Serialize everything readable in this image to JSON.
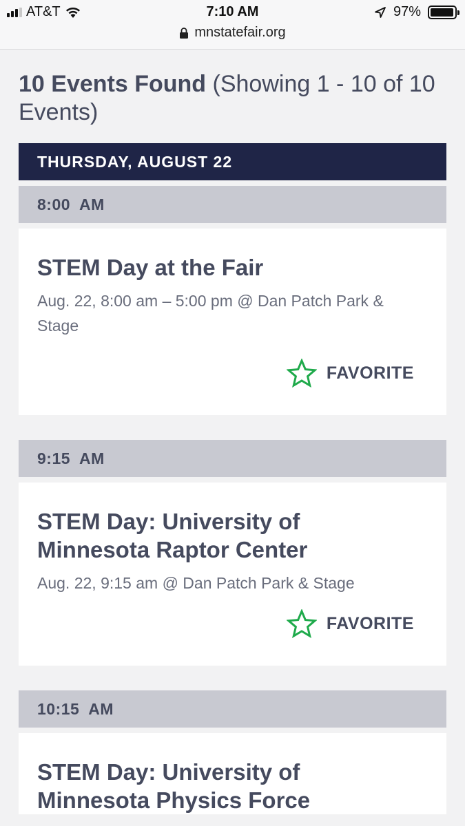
{
  "status_bar": {
    "carrier": "AT&T",
    "time": "7:10 AM",
    "battery": "97%",
    "battery_level": 0.97,
    "signal_bars": 3
  },
  "browser": {
    "url": "mnstatefair.org"
  },
  "results": {
    "count_label": "10 Events Found",
    "showing_label": "(Showing 1 - 10 of 10 Events)"
  },
  "day": {
    "label": "THURSDAY, AUGUST 22"
  },
  "events": [
    {
      "time": "8:00  AM",
      "title": "STEM Day at the Fair",
      "meta": "Aug. 22, 8:00 am – 5:00 pm @ Dan Patch Park & Stage",
      "favorite_label": "FAVORITE"
    },
    {
      "time": "9:15  AM",
      "title": "STEM Day: University of Minnesota Raptor Center",
      "meta": "Aug. 22, 9:15 am @ Dan Patch Park & Stage",
      "favorite_label": "FAVORITE"
    },
    {
      "time": "10:15  AM",
      "title": "STEM Day: University of Minnesota Physics Force",
      "meta": "",
      "favorite_label": ""
    }
  ],
  "colors": {
    "day_header_bg": "#1f2547",
    "time_header_bg": "#c8c9d1",
    "favorite_star": "#1faa4b",
    "text_primary": "#454a5e"
  },
  "icons": {
    "favorite": "star-outline-icon",
    "location": "location-arrow-icon",
    "lock": "lock-icon",
    "wifi": "wifi-icon"
  }
}
